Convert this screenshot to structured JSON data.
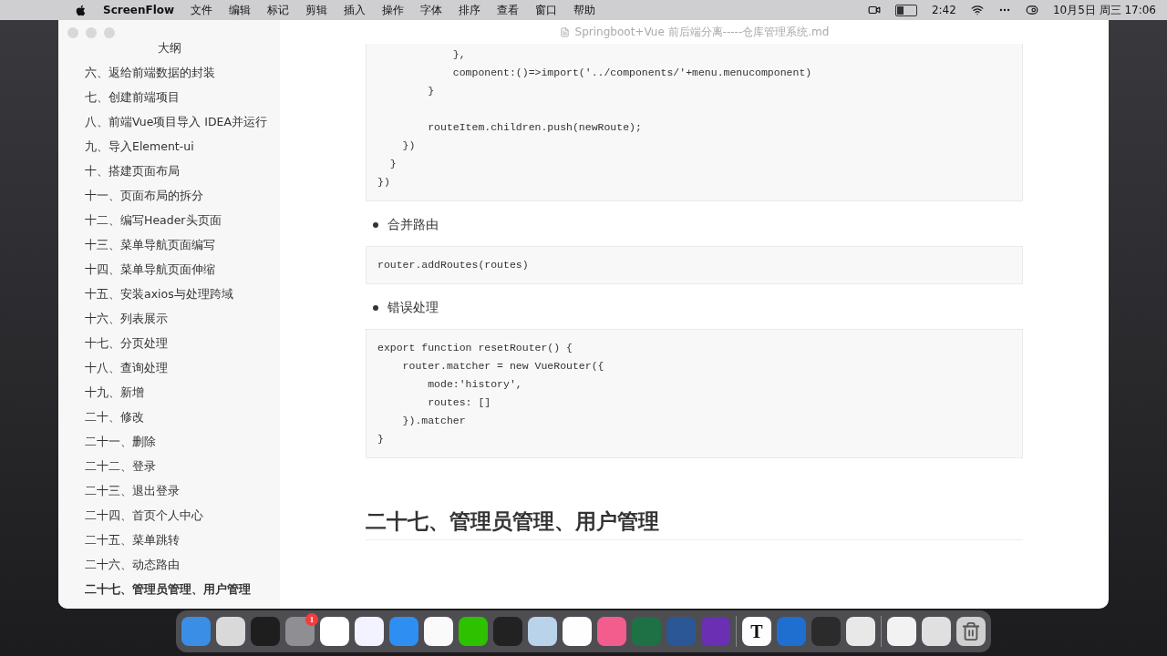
{
  "menu_bar": {
    "app": "ScreenFlow",
    "menus": [
      "文件",
      "编辑",
      "标记",
      "剪辑",
      "插入",
      "操作",
      "字体",
      "排序",
      "查看",
      "窗口",
      "帮助"
    ],
    "battery_time": "2:42",
    "clock": "10月5日 周三  17:06"
  },
  "window": {
    "title": "Springboot+Vue 前后端分离-----仓库管理系统.md"
  },
  "outline": {
    "title": "大纲",
    "items": [
      {
        "label": "六、返给前端数据的封装",
        "selected": false
      },
      {
        "label": "七、创建前端项目",
        "selected": false
      },
      {
        "label": "八、前端Vue项目导入 IDEA并运行",
        "selected": false
      },
      {
        "label": "九、导入Element-ui",
        "selected": false
      },
      {
        "label": "十、搭建页面布局",
        "selected": false
      },
      {
        "label": "十一、页面布局的拆分",
        "selected": false
      },
      {
        "label": "十二、编写Header头页面",
        "selected": false
      },
      {
        "label": "十三、菜单导航页面编写",
        "selected": false
      },
      {
        "label": "十四、菜单导航页面伸缩",
        "selected": false
      },
      {
        "label": "十五、安装axios与处理跨域",
        "selected": false
      },
      {
        "label": "十六、列表展示",
        "selected": false
      },
      {
        "label": "十七、分页处理",
        "selected": false
      },
      {
        "label": "十八、查询处理",
        "selected": false
      },
      {
        "label": "十九、新增",
        "selected": false
      },
      {
        "label": "二十、修改",
        "selected": false
      },
      {
        "label": "二十一、删除",
        "selected": false
      },
      {
        "label": "二十二、登录",
        "selected": false
      },
      {
        "label": "二十三、退出登录",
        "selected": false
      },
      {
        "label": "二十四、首页个人中心",
        "selected": false
      },
      {
        "label": "二十五、菜单跳转",
        "selected": false
      },
      {
        "label": "二十六、动态路由",
        "selected": false
      },
      {
        "label": "二十七、管理员管理、用户管理",
        "selected": true
      }
    ]
  },
  "document": [
    {
      "kind": "code",
      "text": "            },\n            component:()=>import('../components/'+menu.menucomponent)\n        }\n\n        routeItem.children.push(newRoute);\n    })\n  }\n})"
    },
    {
      "kind": "bullet",
      "text": "合并路由"
    },
    {
      "kind": "code",
      "text": "router.addRoutes(routes)"
    },
    {
      "kind": "bullet",
      "text": "错误处理"
    },
    {
      "kind": "code",
      "text": "export function resetRouter() {\n    router.matcher = new VueRouter({\n        mode:'history',\n        routes: []\n    }).matcher\n}"
    },
    {
      "kind": "heading",
      "text": "二十七、管理员管理、用户管理"
    }
  ],
  "dock": [
    {
      "kind": "app",
      "color": "#3a8ee6"
    },
    {
      "kind": "app",
      "color": "#d9d9d9"
    },
    {
      "kind": "app",
      "color": "#1e1e1e"
    },
    {
      "kind": "app",
      "color": "#8e8e93",
      "badge": "1"
    },
    {
      "kind": "app",
      "color": "#ffffff"
    },
    {
      "kind": "app",
      "color": "#f3f3ff"
    },
    {
      "kind": "app",
      "color": "#2f8ef2"
    },
    {
      "kind": "app",
      "color": "#fafafa"
    },
    {
      "kind": "app",
      "color": "#2dc100"
    },
    {
      "kind": "app",
      "color": "#222222"
    },
    {
      "kind": "app",
      "color": "#b8d3ea"
    },
    {
      "kind": "app",
      "color": "#fefefe"
    },
    {
      "kind": "app",
      "color": "#f25d8e"
    },
    {
      "kind": "app",
      "color": "#1e7145"
    },
    {
      "kind": "app",
      "color": "#2b5797"
    },
    {
      "kind": "app",
      "color": "#6b2fb3"
    },
    {
      "kind": "sep"
    },
    {
      "kind": "app",
      "color": "#fdfdfd",
      "glyph": "T"
    },
    {
      "kind": "app",
      "color": "#1f6fd1"
    },
    {
      "kind": "app",
      "color": "#2b2b2b"
    },
    {
      "kind": "app",
      "color": "#e8e8e8"
    },
    {
      "kind": "sep"
    },
    {
      "kind": "app",
      "color": "#f2f2f2"
    },
    {
      "kind": "app",
      "color": "#e0e0e0"
    },
    {
      "kind": "trash",
      "color": "#cfcfcf"
    }
  ]
}
